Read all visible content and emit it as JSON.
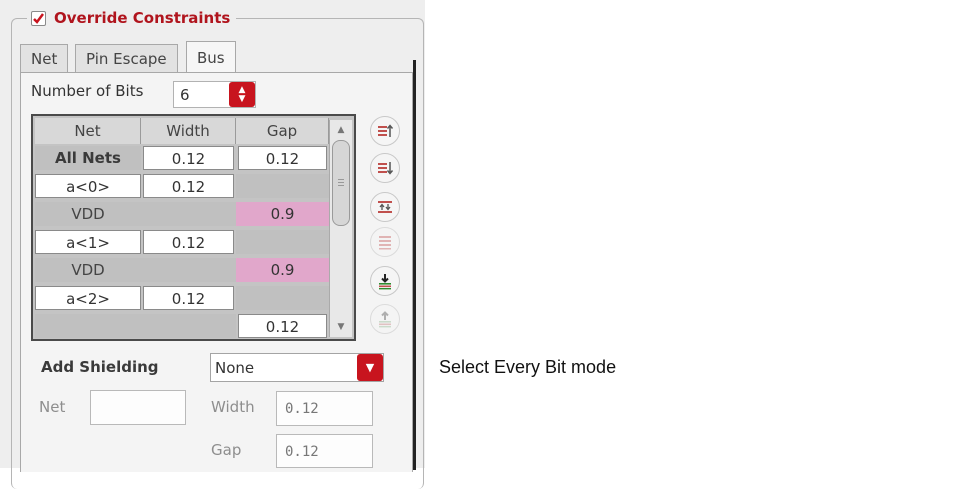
{
  "override": {
    "checked": true,
    "label": "Override Constraints"
  },
  "tabs": [
    {
      "label": "Net",
      "active": false
    },
    {
      "label": "Pin Escape",
      "active": false
    },
    {
      "label": "Bus",
      "active": true
    }
  ],
  "bits": {
    "label": "Number of Bits",
    "value": "6"
  },
  "table": {
    "headers": [
      "Net",
      "Width",
      "Gap"
    ],
    "rows": [
      {
        "net": "All Nets",
        "width": "0.12",
        "gap": "0.12"
      },
      {
        "net": "a<0>",
        "width": "0.12",
        "gap": ""
      },
      {
        "net": "VDD",
        "width": "",
        "gap": "0.9"
      },
      {
        "net": "a<1>",
        "width": "0.12",
        "gap": ""
      },
      {
        "net": "VDD",
        "width": "",
        "gap": "0.9"
      },
      {
        "net": "a<2>",
        "width": "0.12",
        "gap": ""
      },
      {
        "net": "",
        "width": "",
        "gap": "0.12"
      }
    ]
  },
  "side_buttons": [
    {
      "icon": "move-up-icon"
    },
    {
      "icon": "move-down-icon"
    },
    {
      "icon": "swap-icon"
    },
    {
      "icon": "align-icon"
    },
    {
      "icon": "import-icon"
    },
    {
      "icon": "export-icon"
    }
  ],
  "shielding": {
    "label": "Add Shielding",
    "selected": "None",
    "net_label": "Net",
    "net_value": "",
    "width_label": "Width",
    "width_value": "0.12",
    "gap_label": "Gap",
    "gap_value": "0.12"
  },
  "caption": "Select Every Bit mode",
  "colors": {
    "accent": "#c8141e",
    "pink_cell": "#e1a7cb",
    "title_red": "#b0141d"
  }
}
